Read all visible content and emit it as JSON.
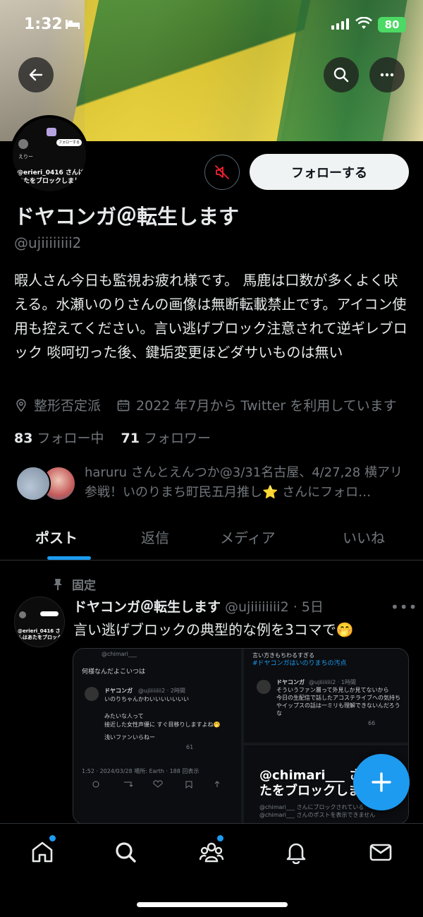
{
  "status_bar": {
    "time": "1:32",
    "battery": "80"
  },
  "profile": {
    "name": "ドヤコンガ＠転生します",
    "handle": "@ujiiiiiiii2",
    "bio": "暇人さん今日も監視お疲れ様です。 馬鹿は口数が多くよく吠える。水瀬いのりさんの画像は無断転載禁止です。アイコン使用も控えてください。言い逃げブロック注意されて逆ギレブロック 啖呵切った後、鍵垢変更ほどダサいものは無い",
    "location": "整形否定派",
    "joined": "2022 年7月から Twitter を利用しています",
    "following_count": "83",
    "following_label": "フォロー中",
    "followers_count": "71",
    "followers_label": "フォロワー",
    "follow_button": "フォローする",
    "followed_by": "haruru さんとえんつか@3/31名古屋、4/27,28 横アリ参戦！いのりまち町民五月推し⭐️ さんにフォロ…",
    "avatar_text": "@erieri_0416 さんはあたをブロックしました",
    "avatar_name": "えりー",
    "avatar_follow": "フォローする"
  },
  "tabs": [
    "ポスト",
    "返信",
    "メディア",
    "いいね"
  ],
  "post": {
    "pinned_label": "固定",
    "author": "ドヤコンガ＠転生します",
    "meta": "@ujiiiiiiii2 · 5日",
    "more": "•••",
    "text": "言い逃げブロックの典型的な例を3コマで🤭",
    "media1": {
      "handle": "@chimari___",
      "line1": "何様なんだよこいつは",
      "qname": "ドヤコンガ",
      "qmeta": "@ujiiiiiiii2 · 2時間",
      "qtext": "いのりちゃんかわいいいいいいい",
      "reply1": "みたいな人って",
      "reply2": "接近した女性声優に すぐ目移りしますよね🤭",
      "reply3": "浅いファンいらねー",
      "count": "61",
      "footer": "1:52 · 2024/03/28 場所: Earth · 188 回表示"
    },
    "media2": {
      "line1": "言い方きもちわるすぎる",
      "hashtag": "#ドヤコンガはいのりまちの汚点",
      "qname": "ドヤコンガ",
      "qmeta": "@ujiiiiiiii2 · 1時間",
      "qtext1": "そういうファン層って外見しか見てないから",
      "qtext2": "今日の生配信で話したアコステライブへの気持ち",
      "qtext3": "やイップスの話は一ミリも理解できないんだろう",
      "qtext4": "な",
      "count": "66"
    },
    "media3": {
      "big1": "@chimari___ さん",
      "big2": "たをブロックしまし",
      "small1": "@chimari___ さんにブロックされている",
      "small2": "@chimari___ さんのポストを表示できません"
    }
  },
  "colors": {
    "accent": "#1d9bf0",
    "background": "#000000",
    "muted": "#71767b"
  }
}
